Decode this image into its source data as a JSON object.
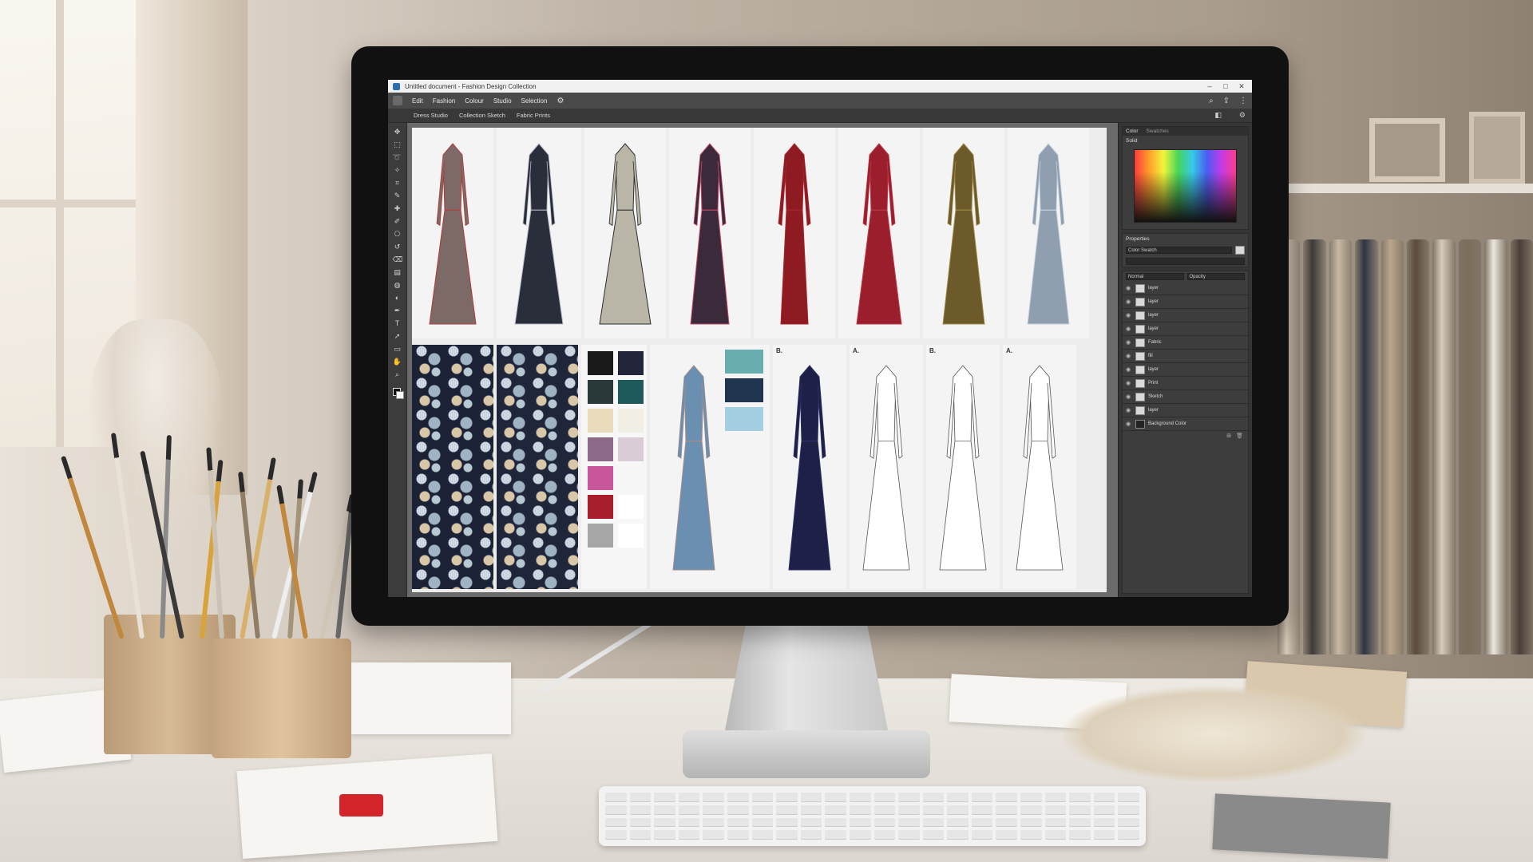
{
  "app": {
    "window_title": "Untitled document - Fashion Design Collection",
    "menu": [
      "Edit",
      "Fashion",
      "Colour",
      "Studio",
      "Selection"
    ],
    "option_bar": [
      "Dress Studio",
      "Collection Sketch",
      "Fabric Prints"
    ],
    "win_controls": [
      "–",
      "□",
      "✕"
    ]
  },
  "tools": [
    "move-icon",
    "marquee-icon",
    "lasso-icon",
    "wand-icon",
    "crop-icon",
    "eyedropper-icon",
    "heal-icon",
    "brush-icon",
    "stamp-icon",
    "history-icon",
    "eraser-icon",
    "gradient-icon",
    "blur-icon",
    "dodge-icon",
    "pen-icon",
    "text-icon",
    "path-icon",
    "shape-icon",
    "hand-icon",
    "zoom-icon"
  ],
  "tool_glyphs": [
    "✥",
    "⬚",
    "➰",
    "✧",
    "⌗",
    "✎",
    "✚",
    "✐",
    "⎔",
    "↺",
    "⌫",
    "▤",
    "◍",
    "◐",
    "✒",
    "T",
    "➚",
    "▭",
    "✋",
    "⌕"
  ],
  "panels": {
    "color_tabs": [
      "Color",
      "Swatches"
    ],
    "color_title": "Solid",
    "properties_title": "Properties",
    "properties_field": "Color Swatch",
    "layers_header": [
      "Normal",
      "Opacity"
    ]
  },
  "layers": [
    {
      "name": "layer",
      "dark": false
    },
    {
      "name": "layer",
      "dark": false
    },
    {
      "name": "layer",
      "dark": false
    },
    {
      "name": "layer",
      "dark": false
    },
    {
      "name": "Fabric",
      "dark": false
    },
    {
      "name": "fill",
      "dark": false
    },
    {
      "name": "layer",
      "dark": false
    },
    {
      "name": "Print",
      "dark": false
    },
    {
      "name": "Sketch",
      "dark": false
    },
    {
      "name": "layer",
      "dark": false
    },
    {
      "name": "Background Color",
      "dark": true
    }
  ],
  "row1_dresses": [
    {
      "fill": "#7c6a66",
      "accent": "#b33b3b",
      "w": 58
    },
    {
      "fill": "#2a2d3a",
      "accent": "#b8b8c8",
      "w": 60
    },
    {
      "fill": "#b9b6a8",
      "accent": "#2c2c2c",
      "w": 64
    },
    {
      "fill": "#3a2a3a",
      "accent": "#c84a6a",
      "w": 48
    },
    {
      "fill": "#8e1a22",
      "accent": "#a82630",
      "w": 34
    },
    {
      "fill": "#9a1e2c",
      "accent": "#c0394a",
      "w": 56
    },
    {
      "fill": "#6c5a2a",
      "accent": "#a08a4a",
      "w": 52
    },
    {
      "fill": "#8f9fb0",
      "accent": "#c9d3de",
      "w": 52
    }
  ],
  "row2_sketches": [
    {
      "label": "",
      "fill": "#6a8fb0",
      "accent": "#a48c88"
    },
    {
      "label": "B.",
      "fill": "#1f2048",
      "accent": "#2e3066"
    },
    {
      "label": "A.",
      "fill": "#ffffff",
      "accent": "#999999"
    },
    {
      "label": "B.",
      "fill": "#ffffff",
      "accent": "#999999"
    },
    {
      "label": "A.",
      "fill": "#ffffff",
      "accent": "#999999"
    }
  ],
  "palette": [
    "#1a1a1a",
    "#23253a",
    "#2a3a3a",
    "#1f5a5a",
    "#e9dcbc",
    "#f1eee4",
    "#8d6a87",
    "#d9ccd6",
    "#c9569a",
    "#f6f6f6",
    "#a81e2c",
    "#ffffff",
    "#a6a6a6",
    "#ffffff"
  ],
  "palette_right": [
    "#69aeae",
    "#20344e",
    "#a3cfe0"
  ],
  "colors": {
    "accent": "#2c6fb0"
  }
}
